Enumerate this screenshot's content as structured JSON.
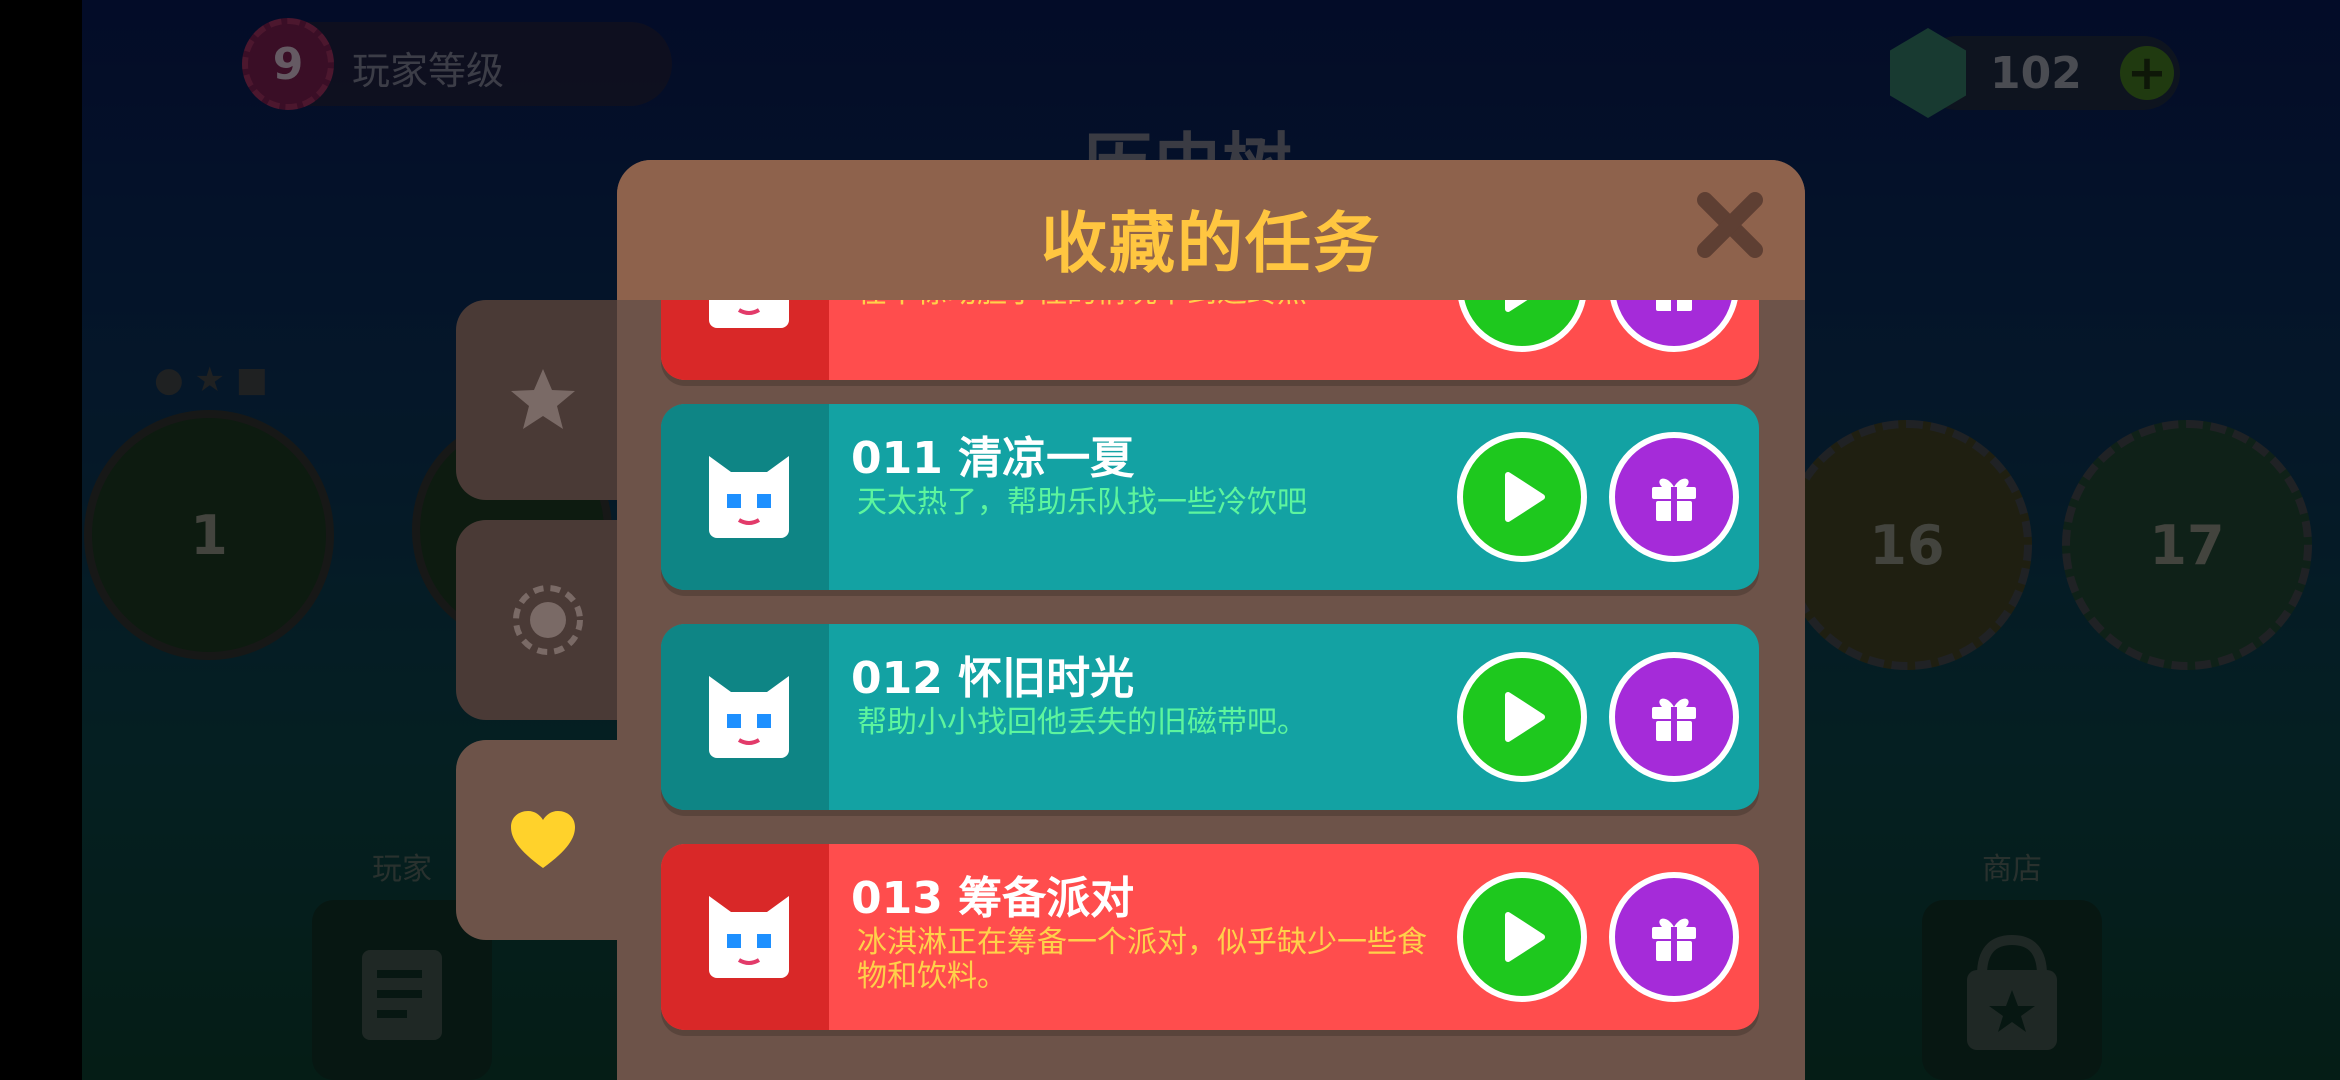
{
  "colors": {
    "dialog_bg": "#6d5349",
    "header_bg": "#8e624c",
    "title_color": "#ffc640",
    "teal_card": "#13a2a3",
    "red_card": "#ff4d4d",
    "play_green": "#1ec81e",
    "gift_purple": "#a52bd9",
    "heart_yellow": "#ffd22b"
  },
  "background": {
    "player_level": "9",
    "player_level_label": "玩家等级",
    "gems": "102",
    "screen_title": "历史树",
    "level_nodes": [
      "1",
      "16",
      "17"
    ],
    "bottom_labels": [
      "玩家",
      "商店"
    ]
  },
  "side_tabs": [
    {
      "icon": "star-icon"
    },
    {
      "icon": "dot-circle-icon"
    },
    {
      "icon": "heart-icon",
      "active": true
    }
  ],
  "dialog": {
    "title": "收藏的任务",
    "close_icon": "close-icon"
  },
  "tasks": [
    {
      "title": "",
      "desc": "在不惊动胆小怪的情况下到达终点",
      "color": "red"
    },
    {
      "title": "011  清凉一夏",
      "desc": "天太热了，帮助乐队找一些冷饮吧",
      "color": "teal"
    },
    {
      "title": "012  怀旧时光",
      "desc": "帮助小小找回他丢失的旧磁带吧。",
      "color": "teal"
    },
    {
      "title": "013  筹备派对",
      "desc": "冰淇淋正在筹备一个派对，似乎缺少一些食物和饮料。",
      "color": "red"
    }
  ]
}
